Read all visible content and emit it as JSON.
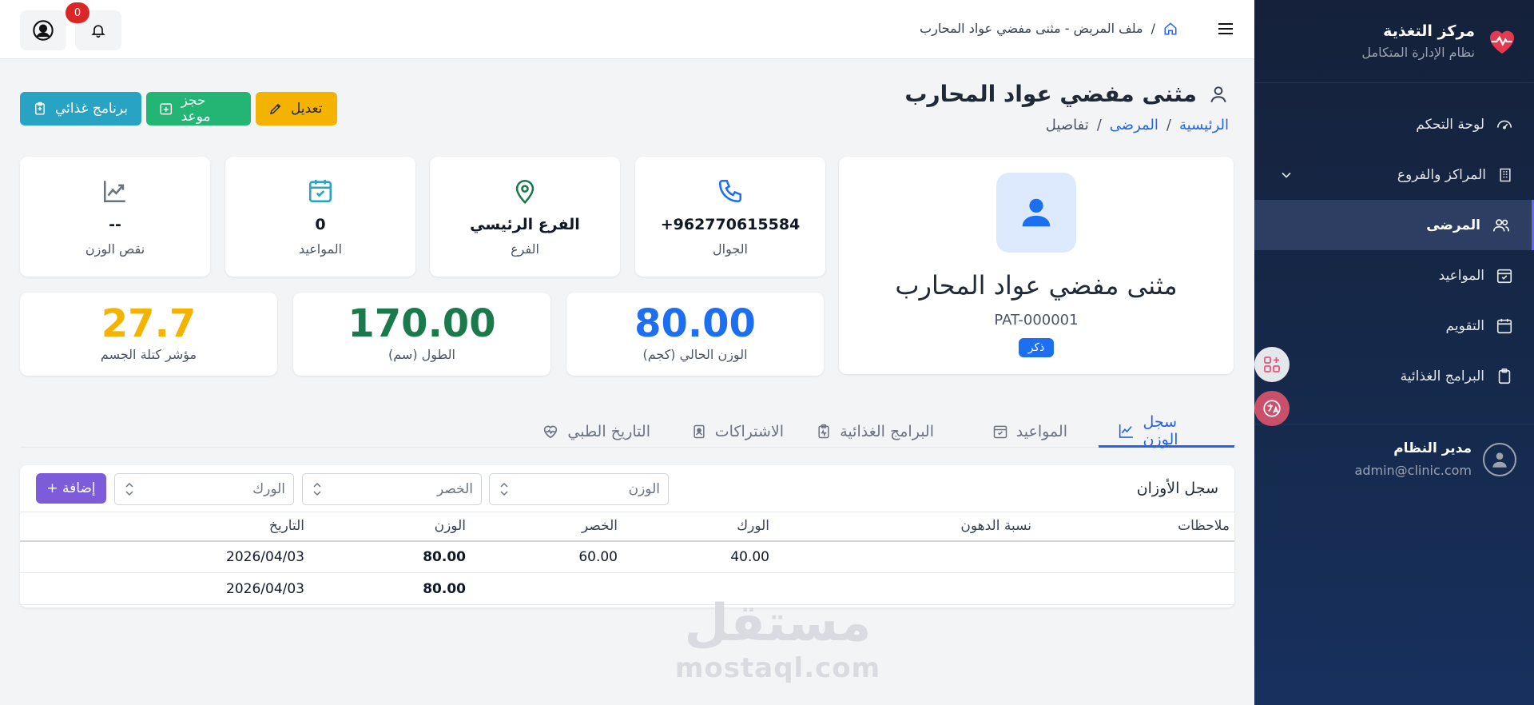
{
  "sidebar": {
    "title": "مركز التغذية",
    "subtitle": "نظام الإدارة المتكامل",
    "items": [
      {
        "label": "لوحة التحكم",
        "icon": "gauge-icon"
      },
      {
        "label": "المراكز والفروع",
        "icon": "building-icon"
      },
      {
        "label": "المرضى",
        "icon": "users-icon"
      },
      {
        "label": "المواعيد",
        "icon": "calendar-check-icon"
      },
      {
        "label": "التقويم",
        "icon": "calendar-icon"
      },
      {
        "label": "البرامج الغذائية",
        "icon": "clipboard-icon"
      }
    ],
    "user": {
      "name": "مدير النظام",
      "email": "admin@clinic.com"
    }
  },
  "topbar": {
    "breadcrumb": "ملف المريض - مثنى مفضي عواد المحارب",
    "breadcrumb_sep": "/",
    "notification_count": "0"
  },
  "page": {
    "title": "مثنى مفضي عواد المحارب",
    "crumbs": {
      "home": "الرئيسية",
      "patients": "المرضى",
      "current": "تفاصيل",
      "sep": "/"
    },
    "actions": {
      "edit": "تعديل",
      "book": "حجز موعد",
      "diet": "برنامج غذائي"
    }
  },
  "profile": {
    "name": "مثنى مفضي عواد المحارب",
    "code": "PAT-000001",
    "gender": "ذكر"
  },
  "info_cards": {
    "phone": {
      "value": "+962770615584",
      "label": "الجوال"
    },
    "branch": {
      "value": "الفرع الرئيسي",
      "label": "الفرع"
    },
    "appointments": {
      "value": "0",
      "label": "المواعيد"
    },
    "weight_loss": {
      "value": "--",
      "label": "نقص الوزن"
    }
  },
  "metrics": {
    "weight": {
      "value": "80.00",
      "label": "الوزن الحالي (كجم)",
      "color": "#1d6ff2"
    },
    "height": {
      "value": "170.00",
      "label": "الطول (سم)",
      "color": "#1a7a4c"
    },
    "bmi": {
      "value": "27.7",
      "label": "مؤشر كتلة الجسم",
      "color": "#f5b301"
    }
  },
  "tabs": {
    "weight_log": "سجل الوزن",
    "appointments": "المواعيد",
    "diet_programs": "البرامج الغذائية",
    "subscriptions": "الاشتراكات",
    "medical_history": "التاريخ الطبي"
  },
  "weight_panel": {
    "title": "سجل الأوزان",
    "weight_placeholder": "الوزن",
    "waist_placeholder": "الخصر",
    "hip_placeholder": "الورك",
    "add_label": "+ إضافة",
    "columns": [
      "التاريخ",
      "الوزن",
      "الخصر",
      "الورك",
      "نسبة الدهون",
      "ملاحظات"
    ],
    "rows": [
      {
        "date": "2026/04/03",
        "weight": "80.00",
        "waist": "60.00",
        "hip": "40.00",
        "fat": "",
        "notes": ""
      },
      {
        "date": "2026/04/03",
        "weight": "80.00",
        "waist": "",
        "hip": "",
        "fat": "",
        "notes": ""
      }
    ]
  },
  "watermark": {
    "ar": "مستقل",
    "en": "mostaql.com"
  }
}
